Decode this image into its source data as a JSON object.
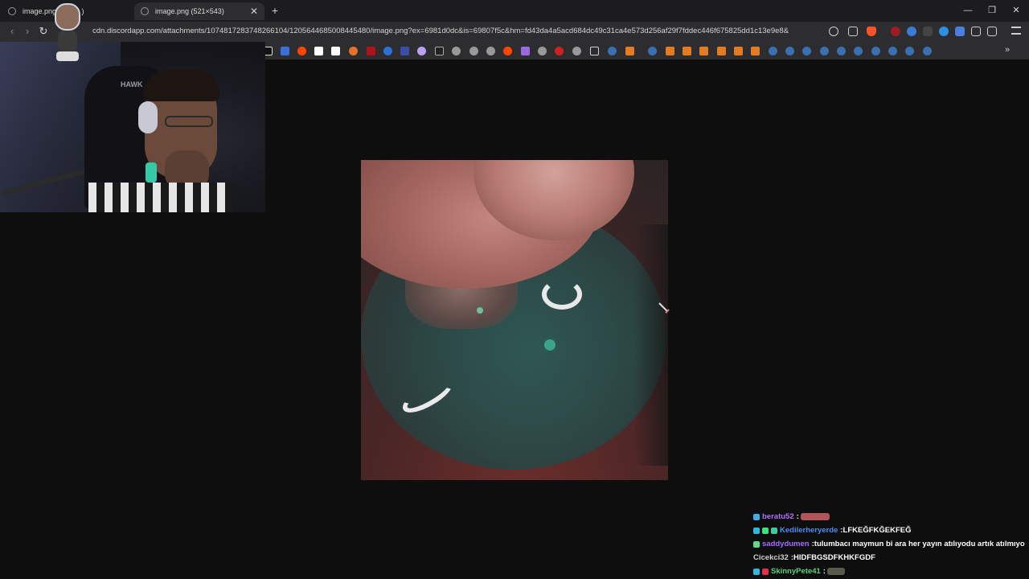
{
  "browser": {
    "tabs": [
      {
        "label": "image.png (",
        "suffix": ")",
        "active": false
      },
      {
        "label": "image.png (521×543)",
        "active": true
      }
    ],
    "new_tab_label": "+",
    "window_controls": [
      "—",
      "❐",
      "✕"
    ],
    "nav": {
      "back": "‹",
      "forward": "›",
      "reload": "↻"
    },
    "url": "cdn.discordapp.com/attachments/1074817283748266104/1205644685008445480/image.png?ex=6981d0dc&is=69807f5c&hm=fd43da4a5acd684dc49c31ca4e573d256af29f7fddec446f675825dd1c13e9e8&",
    "bookmarks_overflow": "»",
    "webcam_chair_label": "HAWK"
  },
  "colors": {
    "accent": "#9146ff",
    "brave": "#fb542b"
  },
  "chat": [
    {
      "user": "beratu52",
      "user_color": "#b26fff",
      "message": "",
      "badges": [
        "#3fb0e6"
      ],
      "emote": "#b0555a"
    },
    {
      "user": "Kedilerheryerde",
      "user_color": "#4c8df5",
      "message": "LFKEĞFKĞEKFEĞ",
      "badges": [
        "#2fb7e0",
        "#3de07a",
        "#3dc8a0"
      ],
      "emote": null
    },
    {
      "user": "saddydumen",
      "user_color": "#a76bff",
      "message": "tulumbacı maymun bi ara her yayın atılıyodu artık atılmıyo",
      "badges": [
        "#5fd98a"
      ],
      "emote": null
    },
    {
      "user": "Cicekci32",
      "user_color": "#cfcfcf",
      "message": "HIDFBGSDFKHKFGDF",
      "badges": [],
      "emote": null
    },
    {
      "user": "SkinnyPete41",
      "user_color": "#5bd07a",
      "message": "",
      "badges": [
        "#2fb7e0",
        "#e0304a"
      ],
      "emote": "#5a5a4a"
    }
  ]
}
